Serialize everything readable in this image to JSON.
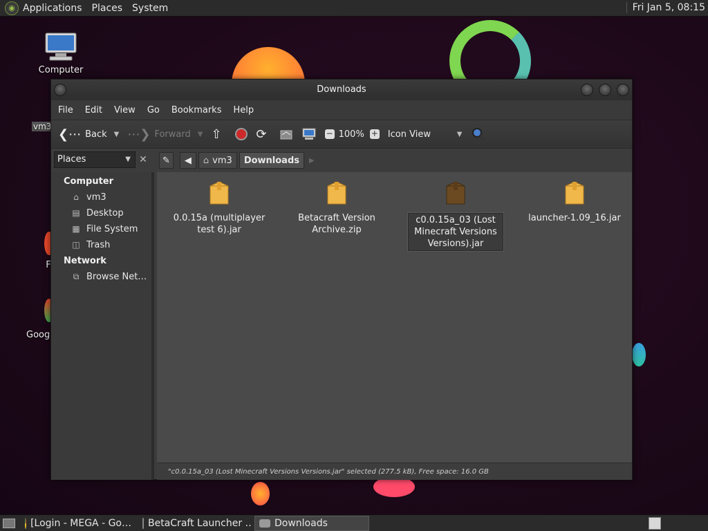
{
  "top_panel": {
    "menus": [
      "Applications",
      "Places",
      "System"
    ],
    "clock": "Fri Jan  5, 08:15"
  },
  "desktop": {
    "icons": [
      {
        "label": "Computer",
        "icon": "computer-icon"
      },
      {
        "label": "vm3",
        "icon": "home-folder-icon"
      },
      {
        "label": "F",
        "icon": "firefox-icon"
      },
      {
        "label": "Goog",
        "icon": "chrome-icon"
      }
    ]
  },
  "window": {
    "title": "Downloads",
    "menus": [
      "File",
      "Edit",
      "View",
      "Go",
      "Bookmarks",
      "Help"
    ],
    "toolbar": {
      "back": "Back",
      "forward": "Forward",
      "zoom": "100%",
      "view_mode": "Icon View"
    },
    "side_pane": {
      "selector": "Places",
      "sections": [
        {
          "heading": "Computer",
          "items": [
            {
              "label": "vm3",
              "icon": "home-icon"
            },
            {
              "label": "Desktop",
              "icon": "desktop-icon"
            },
            {
              "label": "File System",
              "icon": "drive-icon"
            },
            {
              "label": "Trash",
              "icon": "trash-icon"
            }
          ]
        },
        {
          "heading": "Network",
          "items": [
            {
              "label": "Browse Net…",
              "icon": "network-icon"
            }
          ]
        }
      ]
    },
    "breadcrumbs": [
      "vm3",
      "Downloads"
    ],
    "files": [
      {
        "name": "0.0.15a (multiplayer test 6).jar",
        "line1": "0.0.15a (multiplayer",
        "line2": "test 6).jar",
        "line3": "",
        "selected": false
      },
      {
        "name": "Betacraft Version Archive.zip",
        "line1": "Betacraft Version",
        "line2": "Archive.zip",
        "line3": "",
        "selected": false
      },
      {
        "name": "c0.0.15a_03 (Lost Minecraft Versions Versions).jar",
        "line1": "c0.0.15a_03 (Lost",
        "line2": "Minecraft Versions",
        "line3": "Versions).jar",
        "selected": true
      },
      {
        "name": "launcher-1.09_16.jar",
        "line1": "launcher-1.09_16.jar",
        "line2": "",
        "line3": "",
        "selected": false
      }
    ],
    "status": "\"c0.0.15a_03 (Lost Minecraft Versions Versions.jar\" selected (277.5 kB), Free space: 16.0 GB"
  },
  "taskbar": {
    "tasks": [
      {
        "label": "[Login - MEGA - Go…",
        "icon": "chrome-icon",
        "active": false
      },
      {
        "label": "BetaCraft Launcher …",
        "icon": "java-icon",
        "active": false
      },
      {
        "label": "Downloads",
        "icon": "folder-icon",
        "active": true
      }
    ]
  },
  "colors": {
    "package_icon": "#f0b84a",
    "package_selected": "#6b4a22",
    "window_bg": "#3c3c3c",
    "content_bg": "#4a4a4a"
  }
}
